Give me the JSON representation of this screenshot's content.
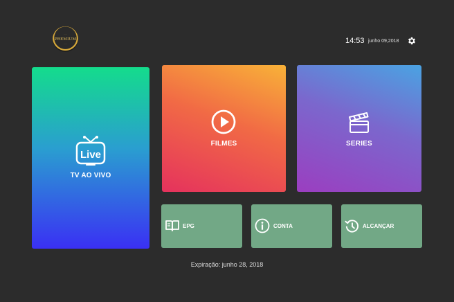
{
  "header": {
    "logo_text": "PREMIUM",
    "logo_small_text": "·····",
    "time": "14:53",
    "date": "junho 09,2018",
    "settings_icon": "gear-icon"
  },
  "tiles": {
    "live": {
      "label": "TV AO VIVO",
      "icon_text": "Live",
      "icon": "tv-icon"
    },
    "filmes": {
      "label": "FILMES",
      "icon": "play-circle-icon"
    },
    "series": {
      "label": "SERIES",
      "icon": "clapperboard-icon"
    },
    "epg": {
      "label": "EPG",
      "icon": "book-icon"
    },
    "conta": {
      "label": "CONTA",
      "icon": "info-icon"
    },
    "alcancar": {
      "label": "ALCANÇAR",
      "icon": "history-icon"
    }
  },
  "footer": {
    "expiry": "Expiração: junho 28, 2018"
  },
  "colors": {
    "background": "#2c2c2c",
    "small_tile": "#72a886"
  }
}
